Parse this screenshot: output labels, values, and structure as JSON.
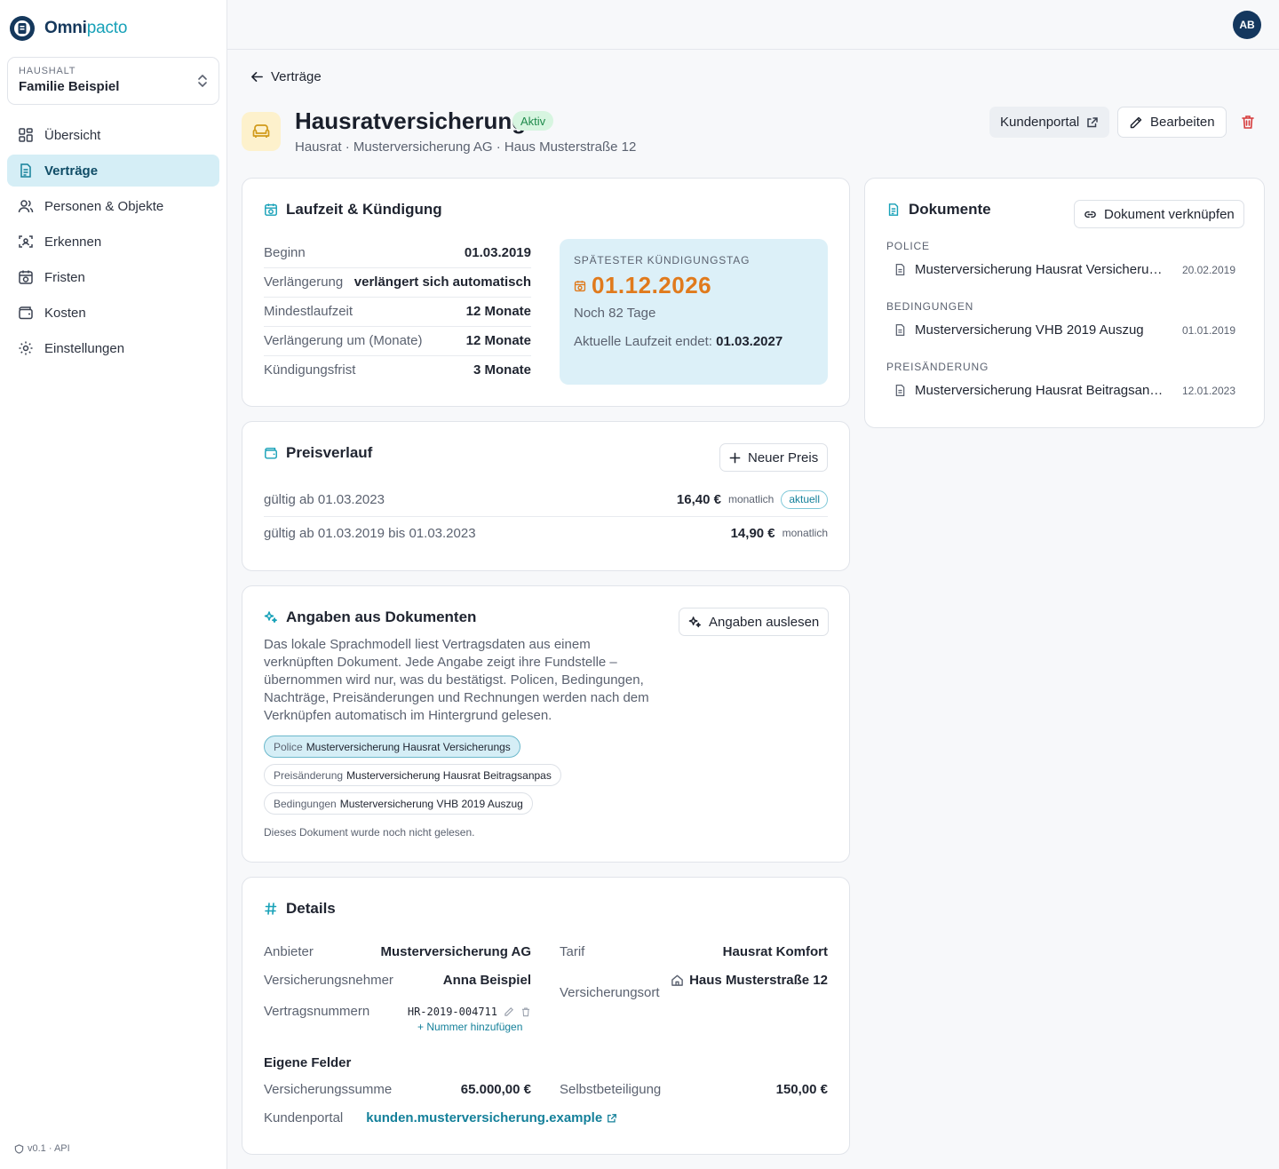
{
  "brand": {
    "name_a": "Omni",
    "name_b": "pacto"
  },
  "household": {
    "label": "HAUSHALT",
    "value": "Familie Beispiel"
  },
  "nav": [
    {
      "label": "Übersicht",
      "icon": "dashboard-icon"
    },
    {
      "label": "Verträge",
      "icon": "document-icon",
      "active": true
    },
    {
      "label": "Personen & Objekte",
      "icon": "users-icon"
    },
    {
      "label": "Erkennen",
      "icon": "scan-icon"
    },
    {
      "label": "Fristen",
      "icon": "calendar-clock-icon"
    },
    {
      "label": "Kosten",
      "icon": "wallet-icon"
    },
    {
      "label": "Einstellungen",
      "icon": "gear-icon"
    }
  ],
  "version": "v0.1 · API",
  "user": {
    "initials": "AB"
  },
  "back_label": "Verträge",
  "contract": {
    "title": "Hausratversicherung",
    "status": "Aktiv",
    "subtitle": "Hausrat · Musterversicherung AG · Haus Musterstraße 12",
    "actions": {
      "portal": "Kundenportal",
      "edit": "Bearbeiten"
    }
  },
  "term": {
    "heading": "Laufzeit & Kündigung",
    "rows": [
      {
        "k": "Beginn",
        "v": "01.03.2019"
      },
      {
        "k": "Verlängerung",
        "v": "verlängert sich automatisch"
      },
      {
        "k": "Mindestlaufzeit",
        "v": "12 Monate"
      },
      {
        "k": "Verlängerung um (Monate)",
        "v": "12 Monate"
      },
      {
        "k": "Kündigungsfrist",
        "v": "3 Monate"
      }
    ],
    "deadline": {
      "label": "SPÄTESTER KÜNDIGUNGSTAG",
      "date": "01.12.2026",
      "remaining": "Noch 82 Tage",
      "end_label": "Aktuelle Laufzeit endet:",
      "end_value": "01.03.2027"
    }
  },
  "prices": {
    "heading": "Preisverlauf",
    "new_label": "Neuer Preis",
    "rows": [
      {
        "k": "gültig ab 01.03.2023",
        "amount": "16,40 €",
        "period": "monatlich",
        "badge": "aktuell"
      },
      {
        "k": "gültig ab 01.03.2019 bis 01.03.2023",
        "amount": "14,90 €",
        "period": "monatlich"
      }
    ]
  },
  "extract": {
    "heading": "Angaben aus Dokumenten",
    "button": "Angaben auslesen",
    "description": "Das lokale Sprachmodell liest Vertragsdaten aus einem verknüpften Dokument. Jede Angabe zeigt ihre Fundstelle – übernommen wird nur, was du bestätigst. Policen, Bedingungen, Nachträge, Preisänderungen und Rechnungen werden nach dem Verknüpfen automatisch im Hintergrund gelesen.",
    "chips": [
      {
        "type": "Police",
        "name": "Musterversicherung Hausrat Versicherungs"
      },
      {
        "type": "Preisänderung",
        "name": "Musterversicherung Hausrat Beitragsanpas"
      },
      {
        "type": "Bedingungen",
        "name": "Musterversicherung VHB 2019 Auszug"
      }
    ],
    "note": "Dieses Dokument wurde noch nicht gelesen."
  },
  "details": {
    "heading": "Details",
    "provider_k": "Anbieter",
    "provider_v": "Musterversicherung AG",
    "tariff_k": "Tarif",
    "tariff_v": "Hausrat Komfort",
    "holder_k": "Versicherungsnehmer",
    "holder_v": "Anna Beispiel",
    "location_k": "Versicherungsort",
    "location_v": "Haus Musterstraße 12",
    "numbers_k": "Vertragsnummern",
    "number_v": "HR-2019-004711",
    "add_number": "+ Nummer hinzufügen",
    "custom_heading": "Eigene Felder",
    "sum_k": "Versicherungssumme",
    "sum_v": "65.000,00 €",
    "deductible_k": "Selbstbeteiligung",
    "deductible_v": "150,00 €",
    "portal_k": "Kundenportal",
    "portal_v": "kunden.musterversicherung.example"
  },
  "documents": {
    "heading": "Dokumente",
    "link_label": "Dokument verknüpfen",
    "groups": [
      {
        "label": "POLICE",
        "name": "Musterversicherung Hausrat Versicherungsschein",
        "date": "20.02.2019"
      },
      {
        "label": "BEDINGUNGEN",
        "name": "Musterversicherung VHB 2019 Auszug",
        "date": "01.01.2019"
      },
      {
        "label": "PREISÄNDERUNG",
        "name": "Musterversicherung Hausrat Beitragsanpassung",
        "date": "12.01.2023"
      }
    ]
  },
  "colors": {
    "accent": "#17a1b8",
    "deadline": "#e07a1c",
    "danger": "#d63b3b",
    "active_nav": "#d5eef6"
  }
}
